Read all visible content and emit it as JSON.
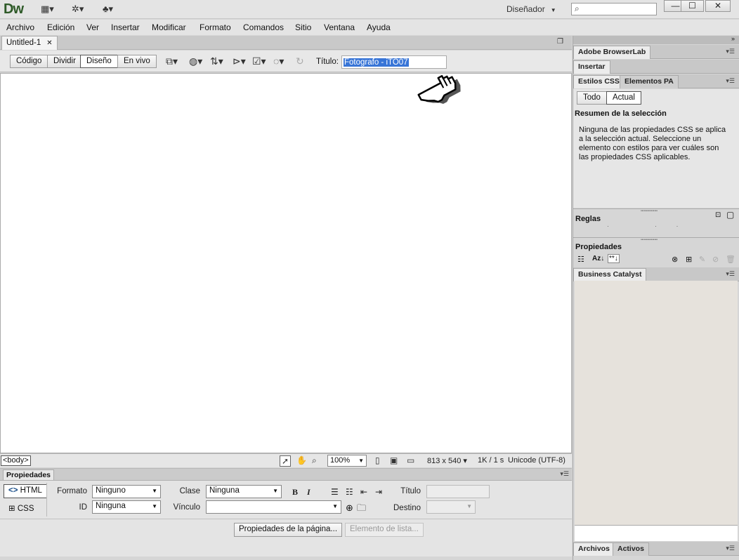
{
  "app": {
    "logo": "Dw",
    "workspace": "Diseñador"
  },
  "menu": [
    "Archivo",
    "Edición",
    "Ver",
    "Insertar",
    "Modificar",
    "Formato",
    "Comandos",
    "Sitio",
    "Ventana",
    "Ayuda"
  ],
  "document": {
    "tab_name": "Untitled-1",
    "views": [
      "Código",
      "Dividir",
      "Diseño",
      "En vivo"
    ],
    "active_view": "Diseño",
    "title_label": "Título:",
    "title_value": "Fotografo - iTO07"
  },
  "status": {
    "tag": "<body>",
    "zoom": "100%",
    "size": "813 x 540",
    "download": "1K / 1 s",
    "encoding": "Unicode (UTF-8)"
  },
  "properties": {
    "tab_label": "Propiedades",
    "html_btn": "HTML",
    "css_btn": "CSS",
    "formato_label": "Formato",
    "formato_value": "Ninguno",
    "clase_label": "Clase",
    "clase_value": "Ninguna",
    "id_label": "ID",
    "id_value": "Ninguna",
    "vinculo_label": "Vínculo",
    "titulo_label": "Título",
    "destino_label": "Destino",
    "page_props_btn": "Propiedades de la página...",
    "list_item_btn": "Elemento de lista..."
  },
  "panels": {
    "browserlab": "Adobe BrowserLab",
    "insertar": "Insertar",
    "estilos_css": "Estilos CSS",
    "elementos_pa": "Elementos PA",
    "todo": "Todo",
    "actual": "Actual",
    "summary_title": "Resumen de la selección",
    "summary_text": "Ninguna de las propiedades CSS se aplica a la selección actual.  Seleccione un elemento con estilos para ver cuáles son las propiedades CSS aplicables.",
    "reglas": "Reglas",
    "propiedades": "Propiedades",
    "business_catalyst": "Business Catalyst",
    "archivos": "Archivos",
    "activos": "Activos"
  }
}
